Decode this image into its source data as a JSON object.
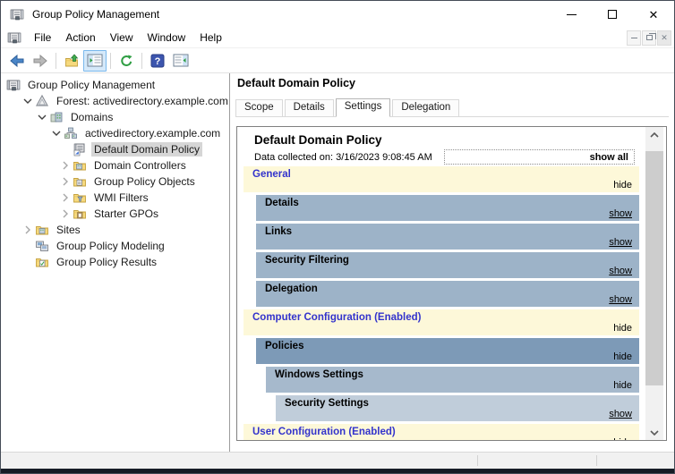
{
  "window": {
    "title": "Group Policy Management",
    "controls": [
      "minimize",
      "maximize",
      "close"
    ],
    "mdi_controls": [
      "minimize",
      "restore",
      "close"
    ]
  },
  "menu": {
    "items": [
      "File",
      "Action",
      "View",
      "Window",
      "Help"
    ]
  },
  "toolbar": {
    "buttons": [
      "back",
      "forward",
      "up-one-level",
      "show-console-tree",
      "refresh",
      "help",
      "show-action-pane"
    ],
    "active_button": "show-console-tree"
  },
  "tree": {
    "items": [
      {
        "label": "Group Policy Management",
        "level": 0,
        "expander": "none",
        "icon": "gpmc-icon",
        "selected": false
      },
      {
        "label": "Forest: activedirectory.example.com",
        "level": 1,
        "expander": "expanded",
        "icon": "forest-icon",
        "selected": false
      },
      {
        "label": "Domains",
        "level": 2,
        "expander": "expanded",
        "icon": "domains-icon",
        "selected": false
      },
      {
        "label": "activedirectory.example.com",
        "level": 3,
        "expander": "expanded",
        "icon": "domain-icon",
        "selected": false
      },
      {
        "label": "Default Domain Policy",
        "level": 4,
        "expander": "none",
        "icon": "gpo-link-icon",
        "selected": true
      },
      {
        "label": "Domain Controllers",
        "level": 4,
        "expander": "collapsed",
        "icon": "folder-ou-icon",
        "selected": false
      },
      {
        "label": "Group Policy Objects",
        "level": 4,
        "expander": "collapsed",
        "icon": "folder-gpo-icon",
        "selected": false
      },
      {
        "label": "WMI Filters",
        "level": 4,
        "expander": "collapsed",
        "icon": "folder-wmi-icon",
        "selected": false
      },
      {
        "label": "Starter GPOs",
        "level": 4,
        "expander": "collapsed",
        "icon": "folder-starter-icon",
        "selected": false
      },
      {
        "label": "Sites",
        "level": 1,
        "expander": "collapsed",
        "icon": "folder-sites-icon",
        "selected": false
      },
      {
        "label": "Group Policy Modeling",
        "level": 1,
        "expander": "none",
        "icon": "modeling-icon",
        "selected": false
      },
      {
        "label": "Group Policy Results",
        "level": 1,
        "expander": "none",
        "icon": "results-icon",
        "selected": false
      }
    ]
  },
  "content": {
    "page_title": "Default Domain Policy",
    "tabs": [
      {
        "label": "Scope",
        "active": false
      },
      {
        "label": "Details",
        "active": false
      },
      {
        "label": "Settings",
        "active": true
      },
      {
        "label": "Delegation",
        "active": false
      }
    ]
  },
  "report": {
    "title": "Default Domain Policy",
    "data_collected": "Data collected on: 3/16/2023 9:08:45 AM",
    "show_all_label": "show all",
    "sections": [
      {
        "label": "General",
        "level": 0,
        "style": "cream",
        "action": "hide"
      },
      {
        "label": "Details",
        "level": 1,
        "style": "blue1",
        "action": "show"
      },
      {
        "label": "Links",
        "level": 1,
        "style": "blue1",
        "action": "show"
      },
      {
        "label": "Security Filtering",
        "level": 1,
        "style": "blue1",
        "action": "show"
      },
      {
        "label": "Delegation",
        "level": 1,
        "style": "blue1",
        "action": "show"
      },
      {
        "label": "Computer Configuration (Enabled)",
        "level": 0,
        "style": "cream",
        "action": "hide"
      },
      {
        "label": "Policies",
        "level": 1,
        "style": "blueDark",
        "action": "hide"
      },
      {
        "label": "Windows Settings",
        "level": 2,
        "style": "blue2",
        "action": "hide"
      },
      {
        "label": "Security Settings",
        "level": 3,
        "style": "blue3",
        "action": "show"
      },
      {
        "label": "User Configuration (Enabled)",
        "level": 0,
        "style": "cream",
        "action": "hide"
      }
    ]
  },
  "colors": {
    "cream": "#fdf8d9",
    "blue1": "#9db3c8",
    "blueDark": "#7d9ab7",
    "blue2": "#a6b9cc",
    "blue3": "#c0cdda",
    "section_title_blue": "#3333cc",
    "toolbar_active_bg": "#d5e9fa",
    "selection_gray": "#d6d6d6"
  }
}
